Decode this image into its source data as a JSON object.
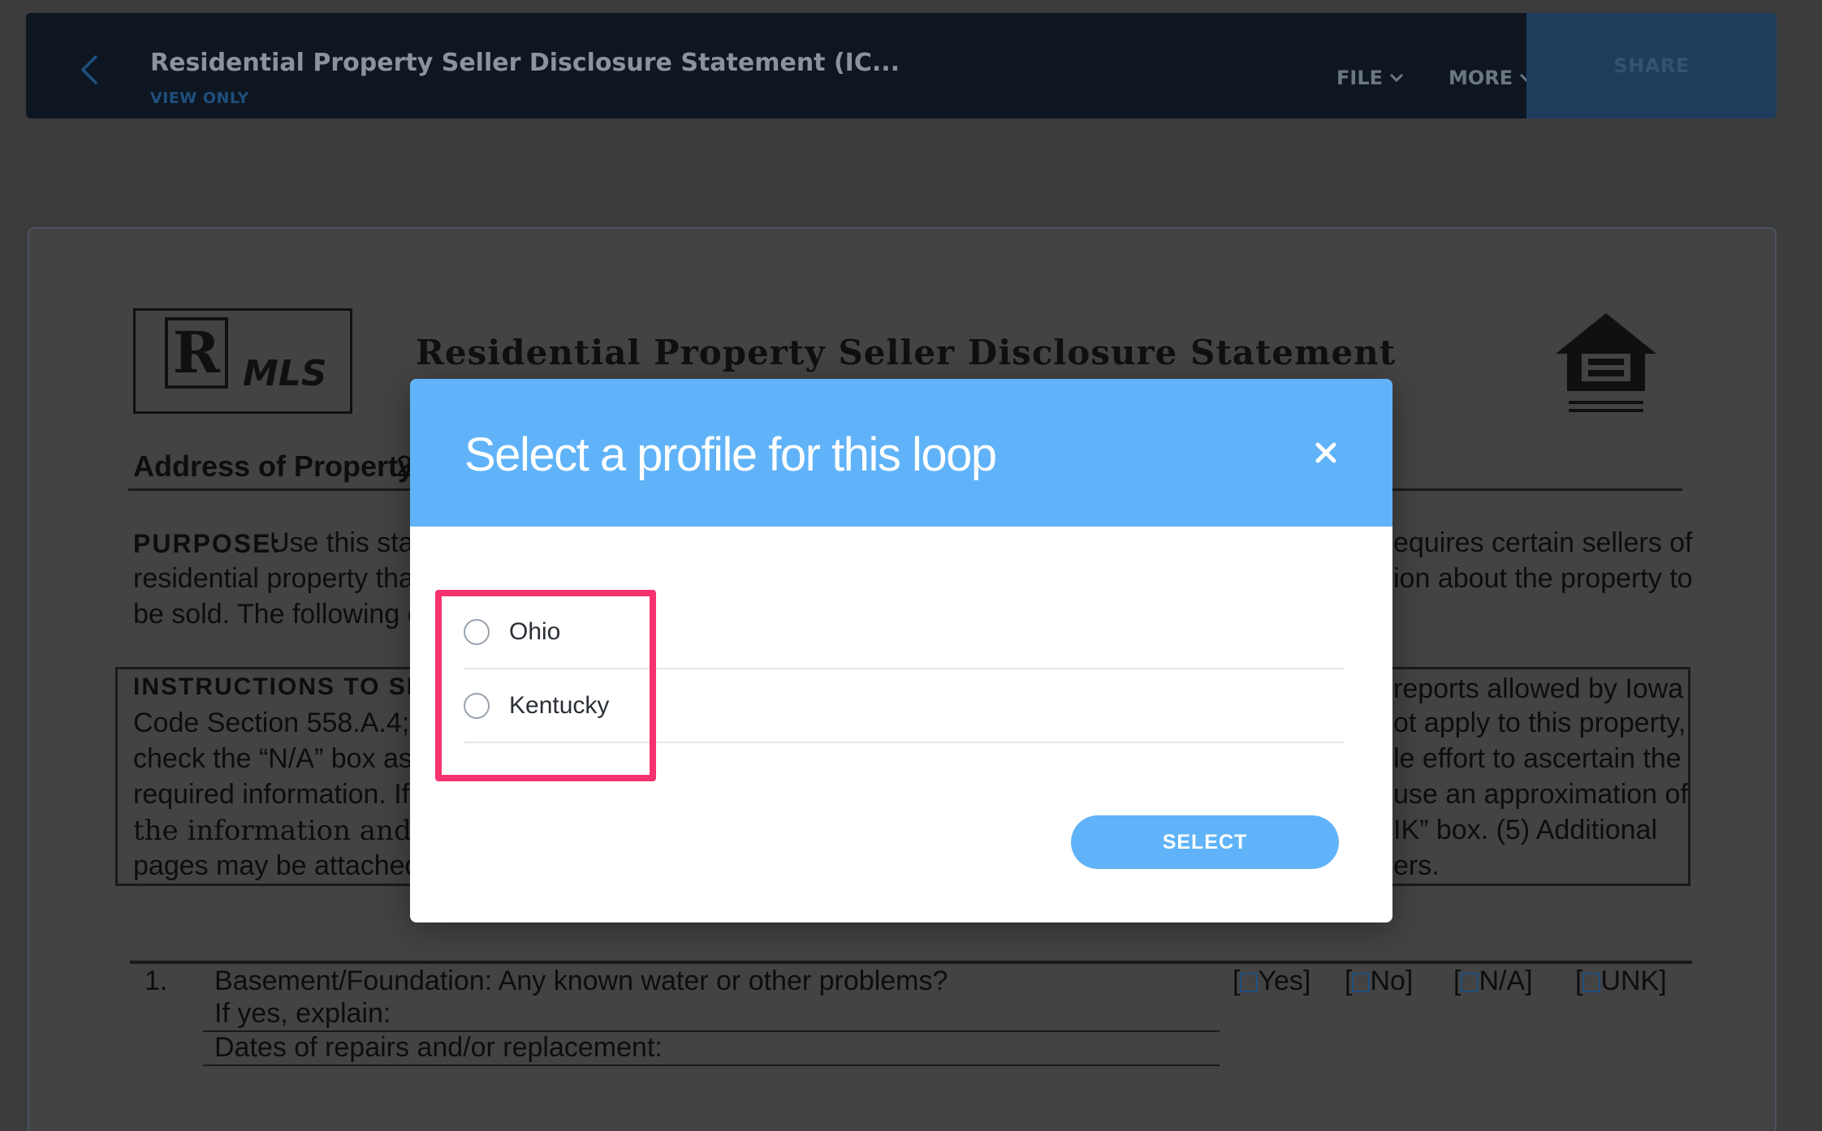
{
  "topbar": {
    "title": "Residential Property Seller Disclosure Statement (IC...",
    "subtitle": "VIEW ONLY",
    "file_label": "FILE",
    "more_label": "MORE",
    "share_label": "SHARE"
  },
  "document": {
    "logo_text": "MLS",
    "logo_r": "R",
    "heading": "Residential Property Seller Disclosure Statement",
    "address_label": "Address of Property:",
    "address_value": "2",
    "purpose_label": "Purpose:",
    "purpose_lines": [
      "Use this stat",
      "residential property that",
      "be sold.  The following c"
    ],
    "purpose_right_lines": [
      "equires certain sellers of",
      "ion about the property to"
    ],
    "instructions_label": "Instructions to Sell",
    "instructions_left": [
      "Code Section 558.A.4; (",
      "check the “N/A” box as",
      "required information.  If",
      "the information and indi",
      "pages may be attached t"
    ],
    "instructions_right": [
      "reports allowed by Iowa",
      "ot apply to this property,",
      "le effort to ascertain the",
      "use an approximation of",
      "IK” box.  (5) Additional",
      "ers."
    ],
    "q1_number": "1.",
    "q1_text": "Basement/Foundation:  Any known water or other problems?",
    "q1_explain": "If yes, explain:",
    "q1_repairs": "Dates of repairs and/or replacement:",
    "checkboxes": [
      "Yes",
      "No",
      "N/A",
      "UNK"
    ]
  },
  "modal": {
    "title": "Select a profile for this loop",
    "options": [
      "Ohio",
      "Kentucky"
    ],
    "select_label": "SELECT"
  },
  "colors": {
    "accent": "#60b3f8",
    "highlight": "#f7336f",
    "toolbar": "#0d1621"
  }
}
